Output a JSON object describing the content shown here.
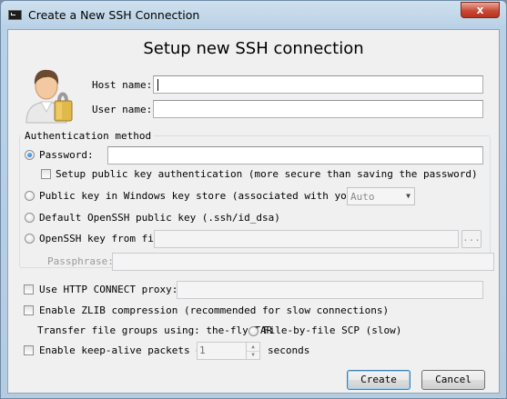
{
  "window": {
    "title": "Create a New SSH Connection",
    "close_label": "x"
  },
  "heading": "Setup new SSH connection",
  "fields": {
    "host_name_label": "Host name:",
    "host_name_value": "",
    "user_name_label": "User name:",
    "user_name_value": ""
  },
  "auth": {
    "group_title": "Authentication method",
    "password_label": "Password:",
    "password_value": "",
    "setup_pubkey_label": "Setup public key authentication (more secure than saving the password)",
    "windows_key_label": "Public key in Windows key store (associated with your us",
    "windows_key_select": "Auto",
    "default_key_label": "Default OpenSSH public key (.ssh/id_dsa)",
    "openssh_file_label": "OpenSSH key from file:",
    "openssh_file_value": "",
    "browse_label": "...",
    "passphrase_label": "Passphrase:",
    "passphrase_value": ""
  },
  "options": {
    "http_proxy_label": "Use HTTP CONNECT proxy:",
    "http_proxy_value": "",
    "zlib_label": "Enable ZLIB compression (recommended for slow connections)",
    "transfer_label": "Transfer file groups using: the-fly TAR",
    "file_by_file_label": "File-by-file SCP (slow)",
    "keepalive_label": "Enable keep-alive packets eve",
    "keepalive_value": "1",
    "seconds_label": "seconds"
  },
  "buttons": {
    "create": "Create",
    "cancel": "Cancel"
  },
  "icons": {
    "title_icon": "terminal-icon",
    "user_icon": "user-lock-icon"
  }
}
